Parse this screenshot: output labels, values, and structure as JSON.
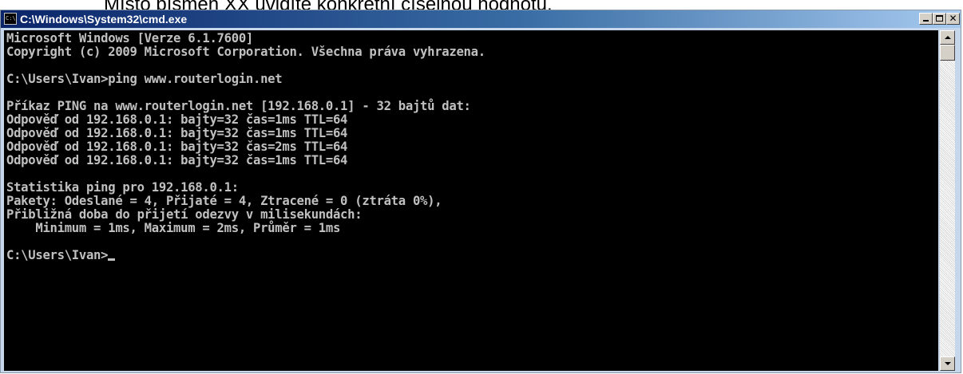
{
  "document": {
    "partial_text": "Místo písmen XX uvidíte konkrétní číselnou hodnotu."
  },
  "window": {
    "title": "C:\\Windows\\System32\\cmd.exe",
    "icon_text": "C:\\",
    "buttons": {
      "minimize": "minimize-icon",
      "maximize": "maximize-icon",
      "close": "✕"
    }
  },
  "console": {
    "lines": [
      "Microsoft Windows [Verze 6.1.7600]",
      "Copyright (c) 2009 Microsoft Corporation. Všechna práva vyhrazena.",
      "",
      "C:\\Users\\Ivan>ping www.routerlogin.net",
      "",
      "Příkaz PING na www.routerlogin.net [192.168.0.1] - 32 bajtů dat:",
      "Odpověď od 192.168.0.1: bajty=32 čas=1ms TTL=64",
      "Odpověď od 192.168.0.1: bajty=32 čas=1ms TTL=64",
      "Odpověď od 192.168.0.1: bajty=32 čas=2ms TTL=64",
      "Odpověď od 192.168.0.1: bajty=32 čas=1ms TTL=64",
      "",
      "Statistika ping pro 192.168.0.1:",
      "Pakety: Odeslané = 4, Přijaté = 4, Ztracené = 0 (ztráta 0%),",
      "Přibližná doba do přijetí odezvy v milisekundách:",
      "    Minimum = 1ms, Maximum = 2ms, Průměr = 1ms",
      "",
      "C:\\Users\\Ivan>"
    ]
  },
  "colors": {
    "console_bg": "#000000",
    "console_fg": "#c0c0c0",
    "titlebar_start": "#0a246a",
    "titlebar_end": "#a6caf0"
  }
}
